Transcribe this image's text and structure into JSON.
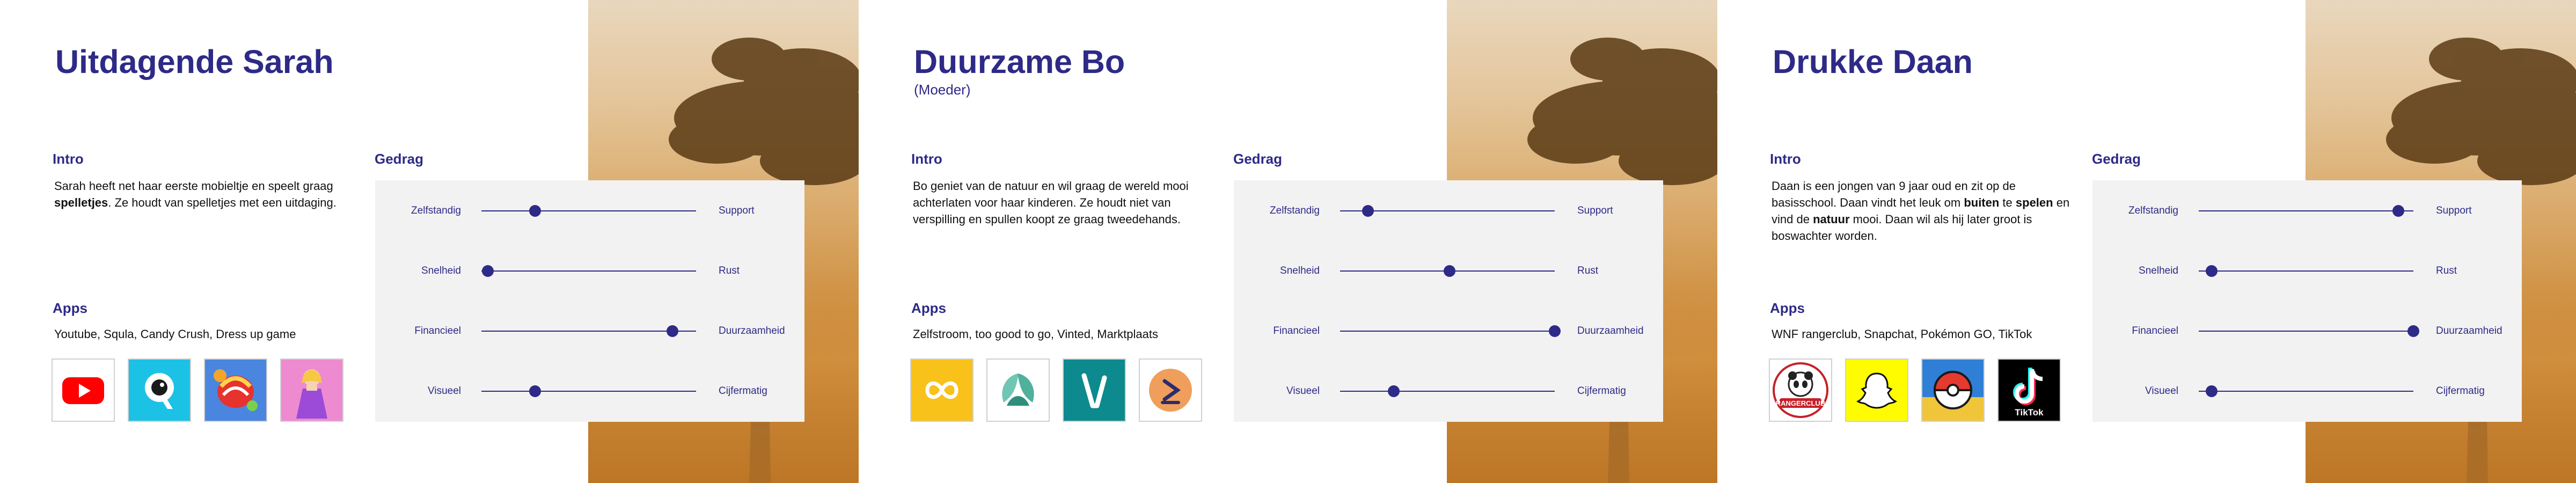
{
  "slides": [
    {
      "title": "Uitdagende Sarah",
      "subtitle": "",
      "intro_heading": "Intro",
      "intro_parts": [
        "Sarah heeft net haar eerste mobieltje en speelt graag ",
        "spelletjes",
        ". Ze houdt van spelletjes met een uitdaging."
      ],
      "gedrag_heading": "Gedrag",
      "apps_heading": "Apps",
      "apps_text": "Youtube, Squla, Candy Crush, Dress up game",
      "app_icons": [
        "youtube-icon",
        "squla-icon",
        "candy-crush-icon",
        "dress-up-game-icon"
      ],
      "sliders": [
        {
          "left": "Zelfstandig",
          "right": "Support",
          "value": 0.25
        },
        {
          "left": "Snelheid",
          "right": "Rust",
          "value": 0.03
        },
        {
          "left": "Financieel",
          "right": "Duurzaamheid",
          "value": 0.89
        },
        {
          "left": "Visueel",
          "right": "Cijfermatig",
          "value": 0.25
        }
      ]
    },
    {
      "title": "Duurzame Bo",
      "subtitle": "(Moeder)",
      "intro_heading": "Intro",
      "intro_parts": [
        "Bo geniet van de natuur en wil graag de wereld mooi achterlaten voor haar kinderen. Ze houdt niet van verspilling en spullen koopt ze graag tweedehands.",
        "",
        ""
      ],
      "gedrag_heading": "Gedrag",
      "apps_heading": "Apps",
      "apps_text": "Zelfstroom, too good to go, Vinted, Marktplaats",
      "app_icons": [
        "zelfstroom-icon",
        "too-good-to-go-icon",
        "vinted-icon",
        "marktplaats-icon"
      ],
      "sliders": [
        {
          "left": "Zelfstandig",
          "right": "Support",
          "value": 0.13
        },
        {
          "left": "Snelheid",
          "right": "Rust",
          "value": 0.51
        },
        {
          "left": "Financieel",
          "right": "Duurzaamheid",
          "value": 1.0
        },
        {
          "left": "Visueel",
          "right": "Cijfermatig",
          "value": 0.25
        }
      ]
    },
    {
      "title": "Drukke Daan",
      "subtitle": "",
      "intro_heading": "Intro",
      "intro_parts": [
        "Daan is een jongen van 9 jaar oud en zit op de basisschool. Daan vindt het leuk om ",
        "buiten",
        " te ",
        "spelen",
        " en vind de ",
        "natuur",
        " mooi. Daan wil als hij later groot is boswachter worden."
      ],
      "gedrag_heading": "Gedrag",
      "apps_heading": "Apps",
      "apps_text": "WNF rangerclub, Snapchat, Pokémon GO, TikTok",
      "app_icons": [
        "wnf-rangerclub-icon",
        "snapchat-icon",
        "pokemon-go-icon",
        "tiktok-icon"
      ],
      "wnf_label": "RANGERCLUB",
      "tiktok_label": "TikTok",
      "sliders": [
        {
          "left": "Zelfstandig",
          "right": "Support",
          "value": 0.93
        },
        {
          "left": "Snelheid",
          "right": "Rust",
          "value": 0.06
        },
        {
          "left": "Financieel",
          "right": "Duurzaamheid",
          "value": 1.0
        },
        {
          "left": "Visueel",
          "right": "Cijfermatig",
          "value": 0.06
        }
      ]
    }
  ]
}
